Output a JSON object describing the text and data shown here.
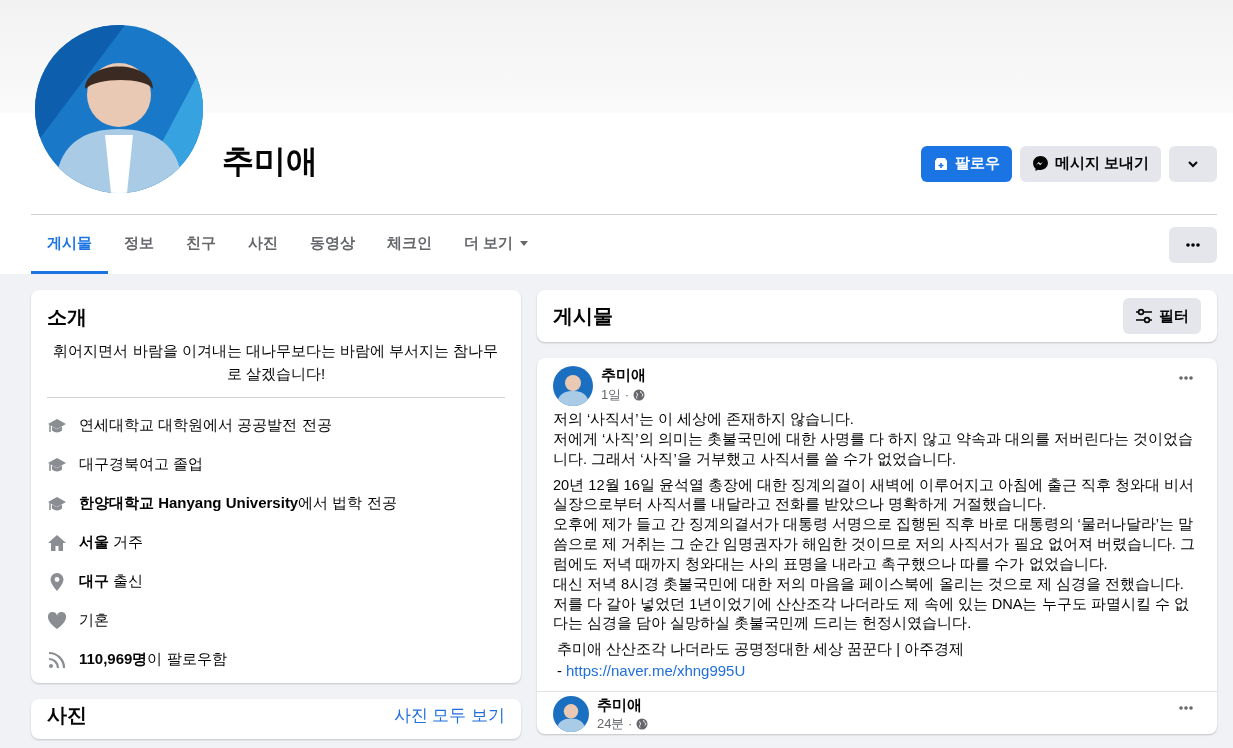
{
  "profile": {
    "name": "추미애"
  },
  "header_buttons": [
    {
      "kind": "follow",
      "label": "팔로우"
    },
    {
      "kind": "message",
      "label": "메시지 보내기"
    },
    {
      "kind": "chevron"
    }
  ],
  "tabs": [
    {
      "label": "게시물",
      "selected": true,
      "kind": "tab"
    },
    {
      "label": "정보",
      "selected": false,
      "kind": "tab"
    },
    {
      "label": "친구",
      "selected": false,
      "kind": "tab"
    },
    {
      "label": "사진",
      "selected": false,
      "kind": "tab"
    },
    {
      "label": "동영상",
      "selected": false,
      "kind": "tab"
    },
    {
      "label": "체크인",
      "selected": false,
      "kind": "tab"
    },
    {
      "label": "더 보기",
      "selected": false,
      "kind": "menu"
    }
  ],
  "intro": {
    "title": "소개",
    "bio": "휘어지면서 바람을 이겨내는 대나무보다는 바람에 부서지는 참나무로 살겠습니다!",
    "items": [
      {
        "kind": "education",
        "text": "연세대학교 대학원에서 공공발전 전공"
      },
      {
        "kind": "education",
        "text": "대구경북여고 졸업"
      },
      {
        "kind": "education",
        "text": "**한양대학교 Hanyang University**에서 법학 전공"
      },
      {
        "kind": "home",
        "text": "**서울** 거주"
      },
      {
        "kind": "place",
        "text": "**대구** 출신"
      },
      {
        "kind": "relationship",
        "text": "기혼"
      },
      {
        "kind": "followers",
        "text": "**110,969명**이 팔로우함"
      }
    ]
  },
  "photos": {
    "title": "사진",
    "link": "사진 모두 보기"
  },
  "posts_header": {
    "title": "게시물",
    "filter_button": "필터"
  },
  "posts": [
    {
      "author": "추미애",
      "time": "1일 ·",
      "paragraphs": [
        "저의 ‘사직서’는 이 세상에 존재하지 않습니다.\n저에게 ‘사직’의 의미는 촛불국민에 대한 사명를 다 하지 않고 약속과 대의를 저버린다는 것이었습니다. 그래서 ‘사직’을 거부했고 사직서를 쓸 수가 없었습니다.",
        "20년 12월 16일 윤석열 총장에 대한 징계의결이 새벽에 이루어지고 아침에 출근 직후 청와대 비서실장으로부터 사직서를 내달라고 전화를 받았으나 명확하게 거절했습니다.\n오후에 제가 들고 간 징계의결서가 대통령 서명으로 집행된 직후 바로 대통령의 ‘물러나달라’는 말씀으로 제 거취는 그 순간 임명권자가 해임한 것이므로 저의 사직서가 필요 없어져 버렸습니다. 그럼에도 저녁 때까지 청와대는 사의 표명을 내라고 촉구했으나 따를 수가 없었습니다.\n대신 저녁 8시경 촛불국민에 대한 저의 마음을 페이스북에 올리는 것으로 제 심경을 전했습니다.\n저를 다 갈아 넣었던 1년이었기에 산산조각 나더라도 제 속에 있는 DNA는 누구도 파멸시킬 수 없다는 심경을 담아 실망하실 촛불국민께 드리는 헌정시였습니다."
      ],
      "link_title": "추미애 산산조각 나더라도 공명정대한 세상 꿈꾼다 | 아주경제",
      "link_prefix": "-",
      "link_url": "https://naver.me/xhng995U"
    },
    {
      "author": "추미애",
      "time": "24분 ·"
    }
  ]
}
